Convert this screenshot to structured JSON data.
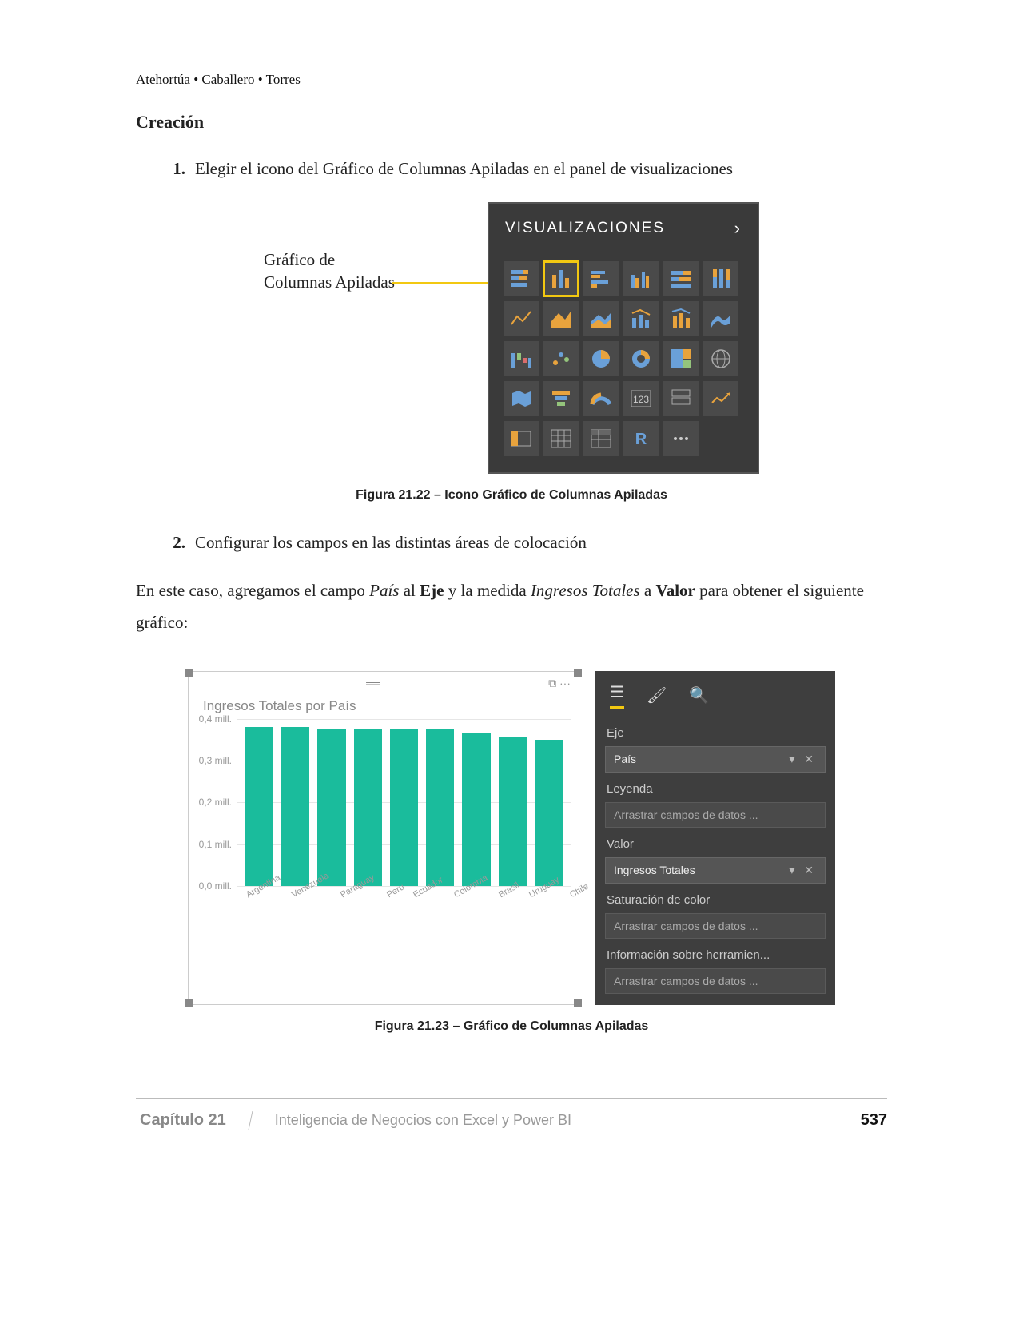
{
  "authors": "Atehortúa • Caballero • Torres",
  "heading": "Creación",
  "step1_num": "1.",
  "step1_text": "Elegir el icono del Gráfico de Columnas Apiladas en el panel de visualizaciones",
  "fig1_annotation_l1": "Gráfico de",
  "fig1_annotation_l2": "Columnas Apiladas",
  "viz_panel_title": "VISUALIZACIONES",
  "fig1_caption": "Figura 21.22 – Icono Gráfico de Columnas Apiladas",
  "step2_num": "2.",
  "step2_text": "Configurar los campos en las distintas áreas de colocación",
  "body_p1_a": "En este caso, agregamos el campo ",
  "body_p1_field1": "País",
  "body_p1_b": " al ",
  "body_p1_axis": "Eje",
  "body_p1_c": " y la medida ",
  "body_p1_field2": "Ingresos Totales",
  "body_p1_d": " a ",
  "body_p1_area": "Valor",
  "body_p1_e": " para obtener el siguiente gráfico:",
  "chart_title": "Ingresos Totales por País",
  "chart_data": {
    "type": "bar",
    "title": "Ingresos Totales por País",
    "xlabel": "",
    "ylabel": "",
    "y_ticks": [
      "0,4 mill.",
      "0,3 mill.",
      "0,2 mill.",
      "0,1 mill.",
      "0,0 mill."
    ],
    "ylim": [
      0,
      0.4
    ],
    "categories": [
      "Argentina",
      "Venezuela",
      "Paraguay",
      "Perú",
      "Ecuador",
      "Colombia",
      "Brasil",
      "Uruguay",
      "Chile"
    ],
    "values": [
      0.38,
      0.38,
      0.375,
      0.375,
      0.375,
      0.375,
      0.365,
      0.355,
      0.35
    ]
  },
  "fields": {
    "eje_label": "Eje",
    "eje_value": "País",
    "leyenda_label": "Leyenda",
    "leyenda_drop": "Arrastrar campos de datos ...",
    "valor_label": "Valor",
    "valor_value": "Ingresos Totales",
    "sat_label": "Saturación de color",
    "sat_drop": "Arrastrar campos de datos ...",
    "info_label": "Información sobre herramien...",
    "info_drop": "Arrastrar campos de datos ..."
  },
  "fig2_caption": "Figura 21.23 – Gráfico de Columnas Apiladas",
  "footer_chapter": "Capítulo 21",
  "footer_book": "Inteligencia de Negocios con Excel y Power BI",
  "footer_page": "537"
}
